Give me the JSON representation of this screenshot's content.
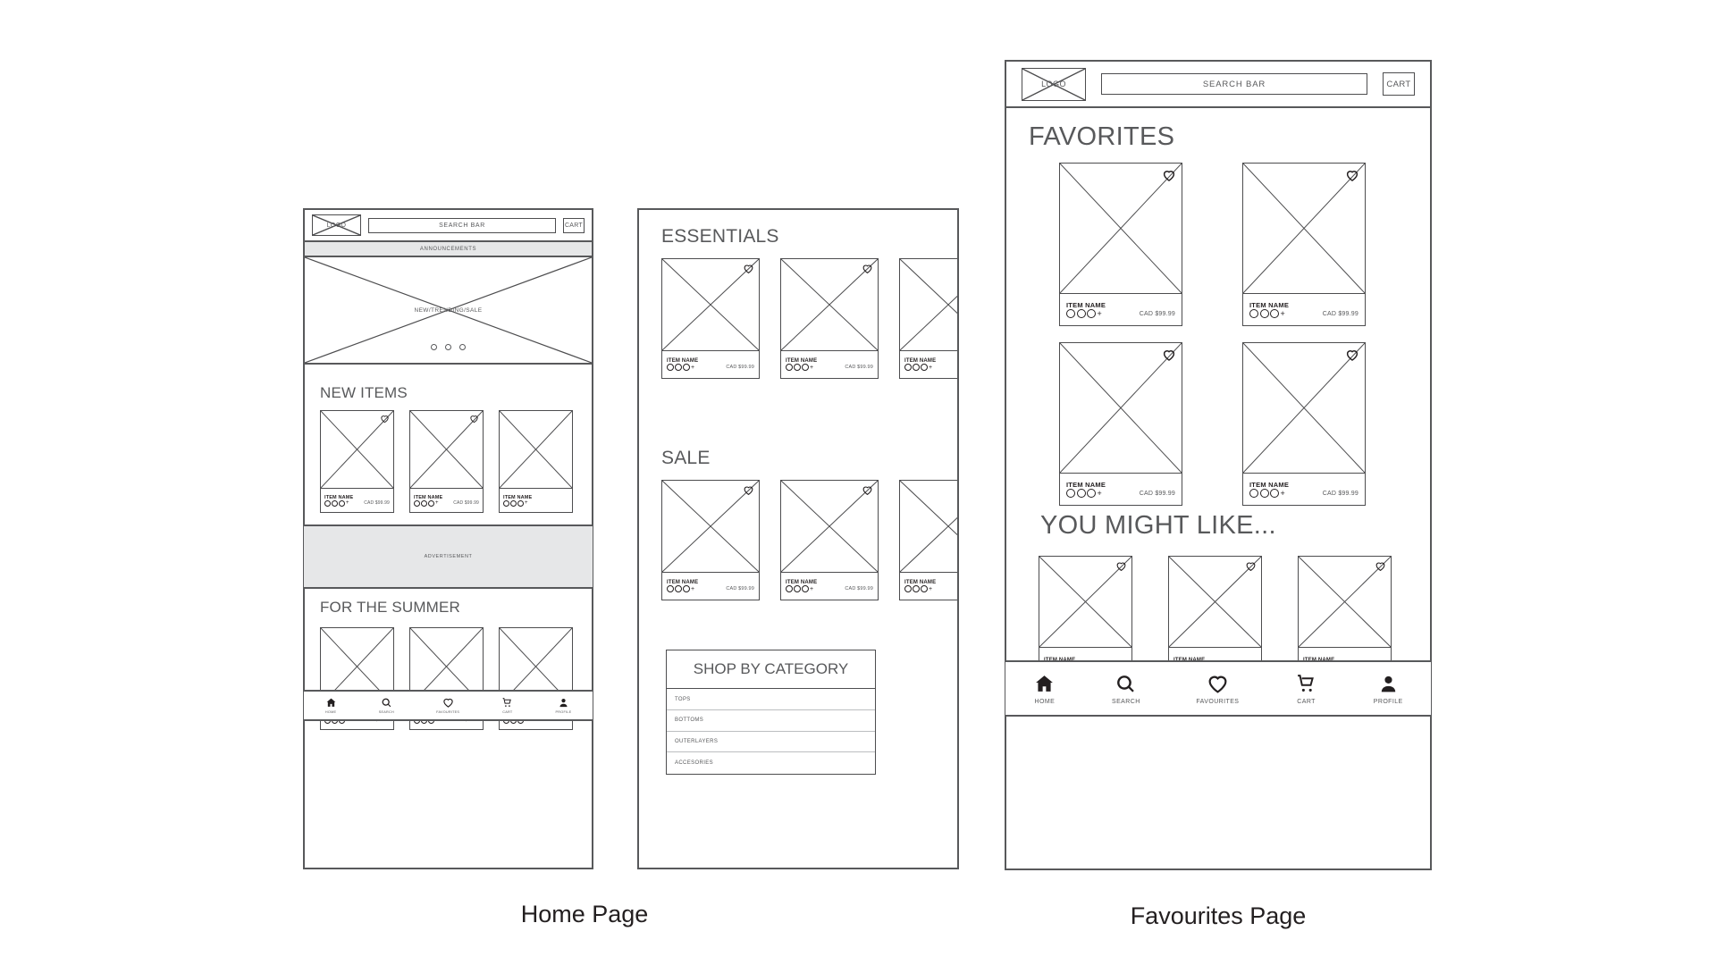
{
  "pages": [
    {
      "id": "home",
      "caption": "Home Page",
      "header": {
        "logo": "LOGO",
        "search": "SEARCH BAR",
        "cart": "CART"
      },
      "announcement": "ANNOUNCEMENTS",
      "hero": {
        "label": "NEW/TRENDING/SALE",
        "dots": 3
      },
      "sections": [
        {
          "title": "NEW ITEMS"
        },
        {
          "title": "FOR THE SUMMER"
        }
      ],
      "advertisement": "ADVERTISEMENT",
      "product": {
        "name": "ITEM NAME",
        "price": "CAD $99.99",
        "swatches": 3,
        "plus": "+"
      }
    },
    {
      "id": "browse",
      "sections": [
        {
          "title": "ESSENTIALS"
        },
        {
          "title": "SALE"
        }
      ],
      "category_table": {
        "heading": "SHOP BY CATEGORY",
        "rows": [
          "TOPS",
          "BOTTOMS",
          "OUTERLAYERS",
          "ACCESORIES"
        ]
      },
      "product": {
        "name": "ITEM NAME",
        "price": "CAD $99.99",
        "swatches": 3,
        "plus": "+"
      }
    },
    {
      "id": "favourites",
      "caption": "Favourites Page",
      "header": {
        "logo": "LOGO",
        "search": "SEARCH BAR",
        "cart": "CART"
      },
      "sections": [
        {
          "title": "FAVORITES"
        },
        {
          "title": "YOU MIGHT LIKE..."
        }
      ],
      "product": {
        "name": "ITEM NAME",
        "price": "CAD $99.99",
        "swatches": 3,
        "plus": "+"
      }
    }
  ],
  "bottom_nav": {
    "items": [
      {
        "label": "HOME",
        "icon": "home-icon"
      },
      {
        "label": "SEARCH",
        "icon": "search-icon"
      },
      {
        "label": "FAVOURITES",
        "icon": "heart-icon"
      },
      {
        "label": "CART",
        "icon": "cart-icon"
      },
      {
        "label": "PROFILE",
        "icon": "profile-icon"
      }
    ]
  },
  "colors": {
    "stroke": "#58595b",
    "thin_stroke": "#4d4d4f",
    "gray_fill": "#e6e7e8",
    "text": "#231f20",
    "background": "#ffffff"
  }
}
